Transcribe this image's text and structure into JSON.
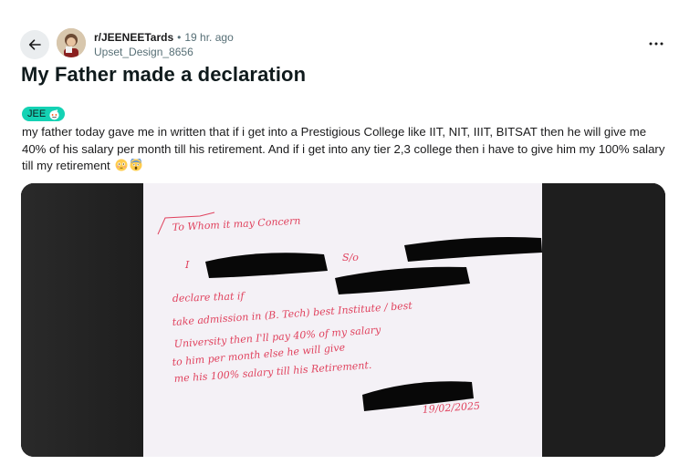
{
  "post": {
    "subreddit": "r/JEENEETards",
    "separator": "•",
    "time": "19 hr. ago",
    "username": "Upset_Design_8656",
    "title": "My Father made a declaration",
    "flair": "JEE",
    "body": "my father today gave me in written that if i get into a Prestigious College like IIT, NIT, IIIT, BITSAT then he will give me 40% of his salary per month till his retirement. And if i get into any tier 2,3 college then i have to give him my 100% salary till my retirement"
  },
  "icons": {
    "back": "arrow-left-icon",
    "more": "more-horizontal-icon",
    "flair_emoji": "snoo-icon",
    "emoji_1": "flushed-face-icon",
    "emoji_2": "screaming-face-icon"
  },
  "image_handwriting": {
    "l1": "To Whom it may Concern",
    "l2a": "I",
    "l2b": "S/o",
    "l3": "declare that if",
    "l4": "take admission in (B. Tech) best Institute / best",
    "l5": "University then I'll pay 40% of my salary",
    "l6": "to him per month else he will give",
    "l7": "me his 100% salary till his Retirement.",
    "date": "19/02/2025"
  },
  "colors": {
    "flair_bg": "#14d2b4",
    "ink": "#e0415d",
    "paper": "#f4f1f6",
    "media_bg": "#1c1c1c"
  }
}
